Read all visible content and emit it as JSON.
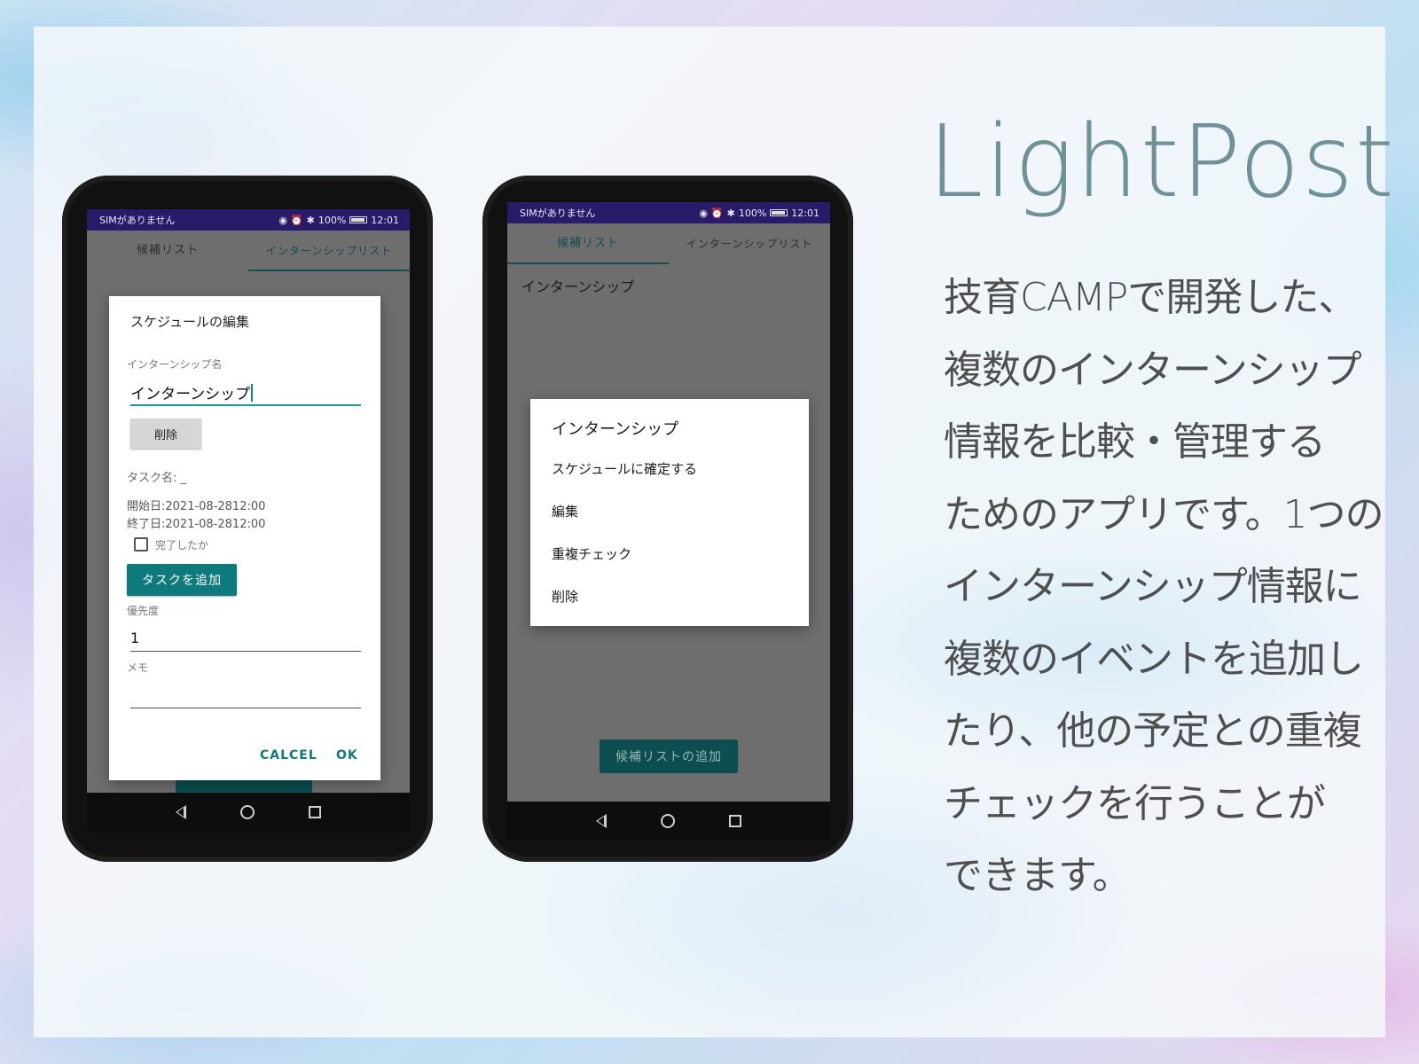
{
  "brand": "LightPost",
  "description_lines": [
    "技育CAMPで開発した、",
    "複数のインターンシップ",
    "情報を比較・管理する",
    "ためのアプリです。1つの",
    "インターンシップ情報に",
    "複数のイベントを追加し",
    "たり、他の予定との重複",
    "チェックを行うことが",
    "できます。"
  ],
  "status_bar": {
    "left": "SIMがありません",
    "battery": "100%",
    "time": "12:01"
  },
  "tabs": {
    "candidates": "候補リスト",
    "internships": "インターンシップリスト"
  },
  "phone1": {
    "dialog": {
      "title": "スケジュールの編集",
      "name_label": "インターンシップ名",
      "name_value": "インターンシップ",
      "delete_button": "削除",
      "task_label": "タスク名:",
      "task_value": "_",
      "start_date": "開始日:2021-08-2812:00",
      "end_date": "終了日:2021-08-2812:00",
      "done_label": "完了したか",
      "add_task_button": "タスクを追加",
      "priority_label": "優先度",
      "priority_value": "1",
      "memo_label": "メモ",
      "cancel_button": "CALCEL",
      "ok_button": "OK"
    }
  },
  "phone2": {
    "list_item": "インターンシップ",
    "menu": {
      "title": "インターンシップ",
      "items": [
        "スケジュールに確定する",
        "編集",
        "重複チェック",
        "削除"
      ]
    },
    "add_list_button": "候補リストの追加"
  },
  "icons": {
    "nav": [
      "back-icon",
      "home-icon",
      "recents-icon"
    ],
    "status": [
      "sim-icon",
      "wifi-icon",
      "usb-icon",
      "eye-icon",
      "alarm-icon",
      "bluetooth-icon",
      "mute-icon",
      "battery-icon"
    ]
  },
  "colors": {
    "brand": "#6f9199",
    "accent": "#0e7a7c",
    "status_bar": "#2a1a6a"
  }
}
